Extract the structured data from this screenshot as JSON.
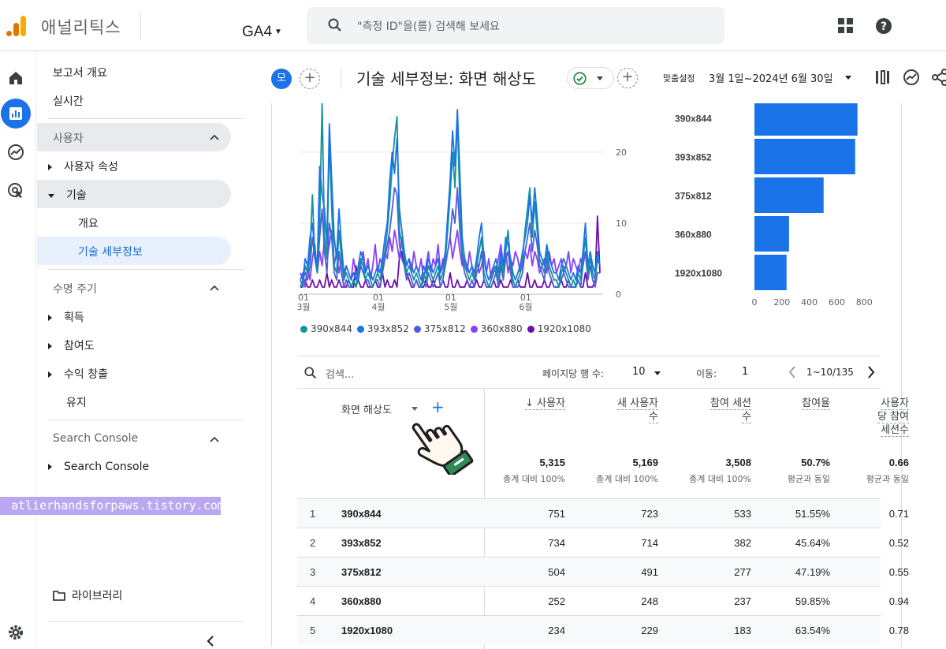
{
  "topbar": {
    "brand": "애널리틱스",
    "property": "GA4",
    "search_placeholder": "\"측정 ID\"을(를) 검색해 보세요"
  },
  "rail": [
    "home-icon",
    "reports-icon",
    "explore-icon",
    "advertising-icon",
    "settings-icon"
  ],
  "sidebar": {
    "overview": "보고서 개요",
    "realtime": "실시간",
    "user_group": "사용자",
    "user_attributes": "사용자 속성",
    "tech": "기술",
    "tech_overview": "개요",
    "tech_detail": "기술 세부정보",
    "lifecycle_group": "수명 주기",
    "acquisition": "획득",
    "engagement": "참여도",
    "monetization": "수익 창출",
    "retention": "유지",
    "sc_group": "Search Console",
    "sc_item": "Search Console",
    "library": "라이브러리"
  },
  "watermark": "atlierhandsforpaws.tistory.com",
  "header": {
    "segment_chip": "모",
    "title": "기술 세부정보: 화면 해상도",
    "custom_label": "맞춤설정",
    "date_range": "3월 1일~2024년 6월 30일"
  },
  "chart_data": [
    {
      "type": "line",
      "x_tick_labels": [
        "01\n3월",
        "01\n4월",
        "01\n5월",
        "01\n6월"
      ],
      "ylim": [
        0,
        26
      ],
      "y_ticks": [
        0,
        10,
        20
      ],
      "series": [
        {
          "name": "390x844",
          "color": "#12939a",
          "values": [
            2,
            1,
            4,
            3,
            6,
            14,
            5,
            3,
            10,
            27,
            8,
            5,
            22,
            12,
            4,
            3,
            9,
            5,
            2,
            3,
            2,
            1,
            2,
            1,
            3,
            5,
            4,
            2,
            3,
            2,
            1,
            2,
            3,
            2,
            4,
            6,
            9,
            13,
            18,
            22,
            25,
            9,
            7,
            5,
            3,
            4,
            3,
            2,
            3,
            2,
            1,
            3,
            2,
            4,
            3,
            2,
            3,
            4,
            2,
            3,
            5,
            9,
            14,
            20,
            15,
            25,
            13,
            6,
            4,
            3,
            2,
            3,
            2,
            4,
            6,
            8,
            3,
            2,
            1,
            2,
            3,
            4,
            2,
            5,
            3,
            6,
            9,
            4,
            2,
            1,
            2,
            3,
            5,
            9,
            12,
            15,
            8,
            13,
            9,
            5,
            4,
            3,
            6,
            4,
            3,
            2,
            2,
            1,
            3,
            4,
            3,
            2,
            1,
            2,
            1,
            3,
            2,
            5,
            8,
            3,
            5,
            3,
            2,
            5,
            4
          ]
        },
        {
          "name": "393x852",
          "color": "#1a73e8",
          "values": [
            3,
            2,
            5,
            4,
            8,
            10,
            6,
            4,
            18,
            14,
            12,
            7,
            24,
            16,
            8,
            5,
            12,
            7,
            3,
            4,
            3,
            2,
            3,
            2,
            4,
            6,
            5,
            3,
            4,
            3,
            2,
            3,
            4,
            3,
            5,
            8,
            10,
            16,
            20,
            17,
            22,
            12,
            9,
            6,
            4,
            5,
            4,
            3,
            4,
            3,
            2,
            4,
            3,
            5,
            4,
            3,
            4,
            5,
            3,
            4,
            6,
            11,
            16,
            23,
            18,
            26,
            17,
            8,
            5,
            4,
            3,
            4,
            3,
            5,
            8,
            10,
            5,
            3,
            2,
            3,
            4,
            5,
            3,
            6,
            4,
            8,
            7,
            5,
            3,
            2,
            3,
            4,
            6,
            8,
            10,
            14,
            10,
            15,
            11,
            6,
            5,
            4,
            7,
            5,
            4,
            3,
            3,
            2,
            4,
            5,
            4,
            3,
            2,
            3,
            2,
            4,
            3,
            6,
            10,
            4,
            6,
            4,
            3,
            6,
            4
          ]
        },
        {
          "name": "375x812",
          "color": "#4c5fd7",
          "values": [
            1,
            2,
            3,
            2,
            4,
            8,
            5,
            3,
            8,
            12,
            6,
            3,
            10,
            8,
            3,
            2,
            6,
            3,
            1,
            2,
            1,
            1,
            2,
            1,
            2,
            4,
            3,
            2,
            2,
            1,
            1,
            2,
            2,
            1,
            3,
            5,
            7,
            9,
            12,
            15,
            14,
            7,
            5,
            4,
            2,
            3,
            2,
            1,
            2,
            1,
            1,
            2,
            1,
            3,
            2,
            1,
            2,
            3,
            1,
            2,
            4,
            6,
            8,
            12,
            10,
            15,
            9,
            5,
            3,
            2,
            1,
            2,
            1,
            3,
            4,
            6,
            2,
            1,
            1,
            1,
            2,
            3,
            1,
            4,
            2,
            5,
            6,
            3,
            1,
            1,
            1,
            2,
            3,
            6,
            8,
            10,
            6,
            9,
            7,
            4,
            3,
            2,
            5,
            3,
            2,
            1,
            1,
            1,
            2,
            3,
            2,
            1,
            1,
            1,
            1,
            2,
            1,
            4,
            6,
            2,
            4,
            2,
            1,
            3,
            3
          ]
        },
        {
          "name": "360x880",
          "color": "#8a3ffc",
          "values": [
            2,
            3,
            1,
            4,
            2,
            5,
            7,
            3,
            6,
            4,
            8,
            5,
            7,
            9,
            4,
            6,
            3,
            5,
            2,
            4,
            3,
            2,
            5,
            3,
            2,
            4,
            6,
            3,
            5,
            2,
            4,
            7,
            3,
            5,
            4,
            6,
            5,
            8,
            6,
            9,
            7,
            5,
            8,
            6,
            4,
            5,
            3,
            6,
            4,
            3,
            5,
            2,
            4,
            6,
            3,
            5,
            4,
            7,
            3,
            5,
            4,
            6,
            8,
            5,
            7,
            9,
            6,
            4,
            5,
            3,
            6,
            4,
            2,
            5,
            3,
            4,
            6,
            3,
            5,
            2,
            4,
            3,
            5,
            7,
            4,
            6,
            3,
            5,
            4,
            6,
            5,
            3,
            4,
            6,
            5,
            7,
            4,
            6,
            5,
            3,
            4,
            5,
            3,
            6,
            4,
            5,
            3,
            4,
            5,
            3,
            4,
            6,
            3,
            5,
            4,
            3,
            5,
            4,
            6,
            3,
            5,
            4,
            3,
            5,
            4
          ]
        },
        {
          "name": "1920x1080",
          "color": "#6a0fa8",
          "values": [
            1,
            1,
            2,
            1,
            1,
            2,
            1,
            1,
            2,
            1,
            1,
            3,
            1,
            2,
            1,
            1,
            2,
            1,
            1,
            1,
            2,
            1,
            1,
            4,
            2,
            1,
            1,
            2,
            1,
            1,
            1,
            2,
            1,
            1,
            3,
            1,
            2,
            1,
            1,
            2,
            1,
            5,
            6,
            4,
            3,
            2,
            1,
            1,
            2,
            1,
            1,
            1,
            2,
            1,
            1,
            2,
            1,
            1,
            1,
            2,
            1,
            1,
            3,
            1,
            1,
            2,
            1,
            1,
            1,
            2,
            1,
            1,
            1,
            2,
            1,
            1,
            2,
            1,
            1,
            1,
            2,
            1,
            1,
            2,
            1,
            1,
            1,
            2,
            1,
            1,
            2,
            1,
            1,
            1,
            3,
            1,
            1,
            2,
            1,
            1,
            1,
            2,
            1,
            1,
            2,
            1,
            1,
            1,
            2,
            1,
            1,
            2,
            1,
            1,
            1,
            2,
            1,
            1,
            3,
            1,
            1,
            1,
            2,
            11,
            3
          ]
        }
      ]
    },
    {
      "type": "bar",
      "orientation": "horizontal",
      "categories": [
        "390x844",
        "393x852",
        "375x812",
        "360x880",
        "1920x1080"
      ],
      "values": [
        751,
        734,
        504,
        252,
        234
      ],
      "color": "#1a73e8",
      "xlim": [
        0,
        850
      ],
      "x_ticks": [
        0,
        200,
        400,
        600,
        800
      ]
    }
  ],
  "table_tools": {
    "search_placeholder": "검색...",
    "rows_per_page_label": "페이지당 행 수:",
    "rows_per_page": "10",
    "goto_label": "이동:",
    "goto_value": "1",
    "range": "1~10/135"
  },
  "table": {
    "dimension_header": "화면 해상도",
    "metrics": [
      {
        "header": [
          "↓ 사용자"
        ],
        "total": "5,315",
        "sub": "총계 대비 100%"
      },
      {
        "header": [
          "새 사용자",
          "수"
        ],
        "total": "5,169",
        "sub": "총계 대비 100%"
      },
      {
        "header": [
          "참여 세션",
          "수"
        ],
        "total": "3,508",
        "sub": "총계 대비 100%"
      },
      {
        "header": [
          "참여율"
        ],
        "total": "50.7%",
        "sub": "평균과 동일"
      },
      {
        "header": [
          "사용자",
          "당 참여",
          "세션수"
        ],
        "total": "0.66",
        "sub": "평균과 동일"
      }
    ],
    "rows": [
      {
        "idx": "1",
        "dim": "390x844",
        "vals": [
          "751",
          "723",
          "533",
          "51.55%",
          "0.71"
        ]
      },
      {
        "idx": "2",
        "dim": "393x852",
        "vals": [
          "734",
          "714",
          "382",
          "45.64%",
          "0.52"
        ]
      },
      {
        "idx": "3",
        "dim": "375x812",
        "vals": [
          "504",
          "491",
          "277",
          "47.19%",
          "0.55"
        ]
      },
      {
        "idx": "4",
        "dim": "360x880",
        "vals": [
          "252",
          "248",
          "237",
          "59.85%",
          "0.94"
        ]
      },
      {
        "idx": "5",
        "dim": "1920x1080",
        "vals": [
          "234",
          "229",
          "183",
          "63.54%",
          "0.78"
        ]
      }
    ]
  }
}
